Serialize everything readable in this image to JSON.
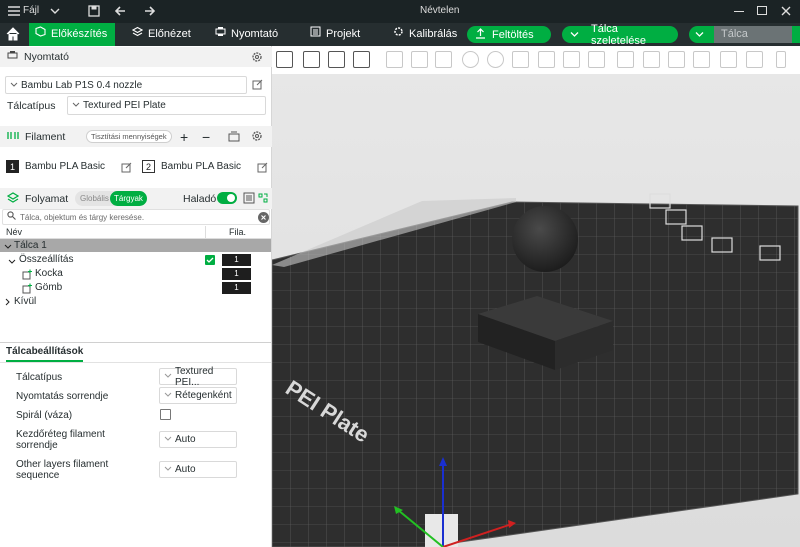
{
  "titlebar": {
    "menu": "Fájl",
    "title": "Névtelen"
  },
  "tabs": [
    {
      "label": "Előkészítés",
      "active": true
    },
    {
      "label": "Előnézet"
    },
    {
      "label": "Nyomtató"
    },
    {
      "label": "Projekt"
    },
    {
      "label": "Kalibrálás"
    }
  ],
  "actions": {
    "upload": "Feltöltés",
    "slice": "Tálca szeletelése",
    "print": "Tálca nyomtatása"
  },
  "printer": {
    "header": "Nyomtató",
    "model": "Bambu Lab P1S 0.4 nozzle",
    "plate_label": "Tálcatípus",
    "plate_value": "Textured PEI Plate"
  },
  "filament": {
    "header": "Filament",
    "flush_button": "Tisztítási mennyiségek",
    "slots": [
      {
        "num": "1",
        "name": "Bambu PLA Basic"
      },
      {
        "num": "2",
        "name": "Bambu PLA Basic"
      }
    ]
  },
  "process": {
    "header": "Folyamat",
    "toggle_global": "Globális",
    "toggle_objects": "Tárgyak",
    "advanced": "Haladó",
    "search_placeholder": "Tálca, objektum és tárgy keresése."
  },
  "object_list": {
    "col_name": "Név",
    "col_fila": "Fila.",
    "plate": "Tálca 1",
    "assembly": "Összeállítás",
    "assembly_fila": "1",
    "parts": [
      {
        "name": "Kocka",
        "fila": "1"
      },
      {
        "name": "Gömb",
        "fila": "1"
      }
    ],
    "outside": "Kívül"
  },
  "plate_settings": {
    "tab": "Tálcabeállítások",
    "rows": [
      {
        "label": "Tálcatípus",
        "value": "Textured PEI..."
      },
      {
        "label": "Nyomtatás sorrendje",
        "value": "Rétegenként"
      },
      {
        "label": "Spirál (váza)",
        "value": ""
      },
      {
        "label": "Kezdőréteg filament sorrendje",
        "value": "Auto"
      },
      {
        "label": "Other layers filament sequence",
        "value": "Auto"
      }
    ]
  },
  "plate_text": "PEI Plate",
  "colors": {
    "accent": "#00ae42",
    "dark": "#262e30",
    "titlebar": "#1b2325"
  }
}
